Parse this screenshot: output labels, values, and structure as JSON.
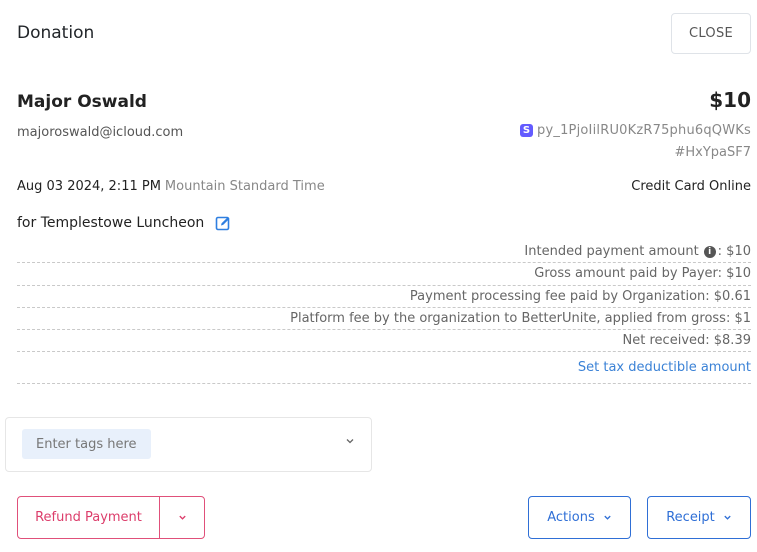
{
  "header": {
    "title": "Donation",
    "close_label": "CLOSE"
  },
  "donor": {
    "name": "Major Oswald",
    "email": "majoroswald@icloud.com"
  },
  "payment": {
    "amount": "$10",
    "stripe_icon_letter": "S",
    "stripe_id": "py_1PjoIilRU0KzR75phu6qQWKs",
    "hash_id": "#HxYpaSF7",
    "date": "Aug 03 2024, 2:11 PM",
    "timezone": "Mountain Standard Time",
    "method": "Credit Card Online",
    "campaign": "for Templestowe Luncheon"
  },
  "fees": {
    "intended_label": "Intended payment amount",
    "intended_value": ": $10",
    "info_icon_glyph": "i",
    "rows": [
      "Gross amount paid by Payer: $10",
      "Payment processing fee paid by Organization: $0.61",
      "Platform fee by the organization to BetterUnite, applied from gross: $1",
      "Net received: $8.39"
    ],
    "tax_link": "Set tax deductible amount"
  },
  "tags": {
    "placeholder": "Enter tags here"
  },
  "footer": {
    "refund_label": "Refund Payment",
    "actions_label": "Actions",
    "receipt_label": "Receipt"
  },
  "colors": {
    "accent": "#2f6fd6",
    "danger": "#dc3d6b",
    "stripe": "#635bff"
  },
  "icons": [
    "edit-icon",
    "info-icon",
    "chevron-down-icon",
    "stripe-icon"
  ]
}
